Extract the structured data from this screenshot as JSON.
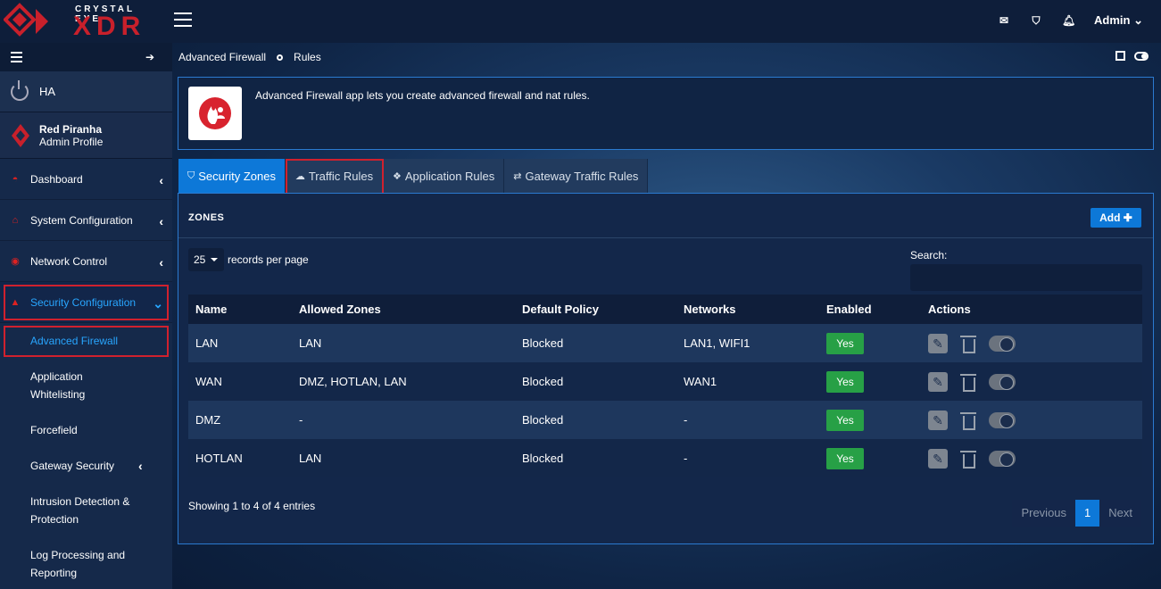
{
  "brand": {
    "top": "CRYSTAL EYE",
    "main": "XDR"
  },
  "header": {
    "user_label": "Admin"
  },
  "sidebar": {
    "ha_label": "HA",
    "profile": {
      "name": "Red Piranha",
      "role": "Admin Profile"
    },
    "items": [
      {
        "label": "Dashboard"
      },
      {
        "label": "System Configuration"
      },
      {
        "label": "Network Control"
      },
      {
        "label": "Security Configuration"
      }
    ],
    "subitems": [
      {
        "label": "Advanced Firewall"
      },
      {
        "label": "Application Whitelisting"
      },
      {
        "label": "Forcefield"
      },
      {
        "label": "Gateway Security"
      },
      {
        "label": "Intrusion Detection & Protection"
      },
      {
        "label": "Log Processing and Reporting"
      }
    ]
  },
  "breadcrumb": {
    "app": "Advanced Firewall",
    "page": "Rules"
  },
  "info": {
    "description": "Advanced Firewall app lets you create advanced firewall and nat rules."
  },
  "tabs": [
    {
      "label": "Security Zones"
    },
    {
      "label": "Traffic Rules"
    },
    {
      "label": "Application Rules"
    },
    {
      "label": "Gateway Traffic Rules"
    }
  ],
  "panel": {
    "title": "ZONES",
    "add_label": "Add",
    "records_value": "25",
    "records_label": "records per page",
    "search_label": "Search:",
    "columns": [
      "Name",
      "Allowed Zones",
      "Default Policy",
      "Networks",
      "Enabled",
      "Actions"
    ],
    "rows": [
      {
        "name": "LAN",
        "allowed": "LAN",
        "policy": "Blocked",
        "networks": "LAN1, WIFI1",
        "enabled": "Yes"
      },
      {
        "name": "WAN",
        "allowed": "DMZ, HOTLAN, LAN",
        "policy": "Blocked",
        "networks": "WAN1",
        "enabled": "Yes"
      },
      {
        "name": "DMZ",
        "allowed": "-",
        "policy": "Blocked",
        "networks": "-",
        "enabled": "Yes"
      },
      {
        "name": "HOTLAN",
        "allowed": "LAN",
        "policy": "Blocked",
        "networks": "-",
        "enabled": "Yes"
      }
    ],
    "showing": "Showing 1 to 4 of 4 entries",
    "pager": {
      "prev": "Previous",
      "current": "1",
      "next": "Next"
    }
  }
}
